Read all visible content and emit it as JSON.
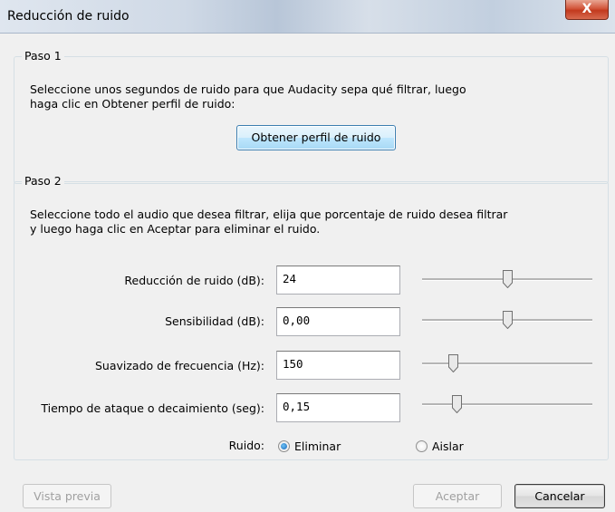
{
  "window": {
    "title": "Reducción de ruido",
    "close_glyph": "X"
  },
  "step1": {
    "label": "Paso 1",
    "description_line1": "Seleccione unos segundos de ruido para que Audacity sepa qué filtrar, luego",
    "description_line2": "haga clic en Obtener perfil de ruido:",
    "button_label": "Obtener perfil de ruido"
  },
  "step2": {
    "label": "Paso 2",
    "description_line1": "Seleccione todo el audio que desea filtrar, elija que porcentaje de ruido desea filtrar",
    "description_line2": "y luego haga clic en Aceptar para eliminar el ruido.",
    "rows": [
      {
        "label": "Reducción de ruido (dB):",
        "value": "24",
        "slider_fraction": 0.5
      },
      {
        "label": "Sensibilidad (dB):",
        "value": "0,00",
        "slider_fraction": 0.5
      },
      {
        "label": "Suavizado de frecuencia (Hz):",
        "value": "150",
        "slider_fraction": 0.18
      },
      {
        "label": "Tiempo de ataque o decaimiento (seg):",
        "value": "0,15",
        "slider_fraction": 0.2
      }
    ],
    "noise": {
      "label": "Ruido:",
      "options": [
        {
          "label": "Eliminar",
          "selected": true
        },
        {
          "label": "Aislar",
          "selected": false
        }
      ]
    }
  },
  "footer": {
    "preview_label": "Vista previa",
    "ok_label": "Aceptar",
    "cancel_label": "Cancelar"
  },
  "colors": {
    "group_border": "#d5dfe5",
    "focus_button": "#bee6fd",
    "radio_selected": "#1a64b8"
  }
}
